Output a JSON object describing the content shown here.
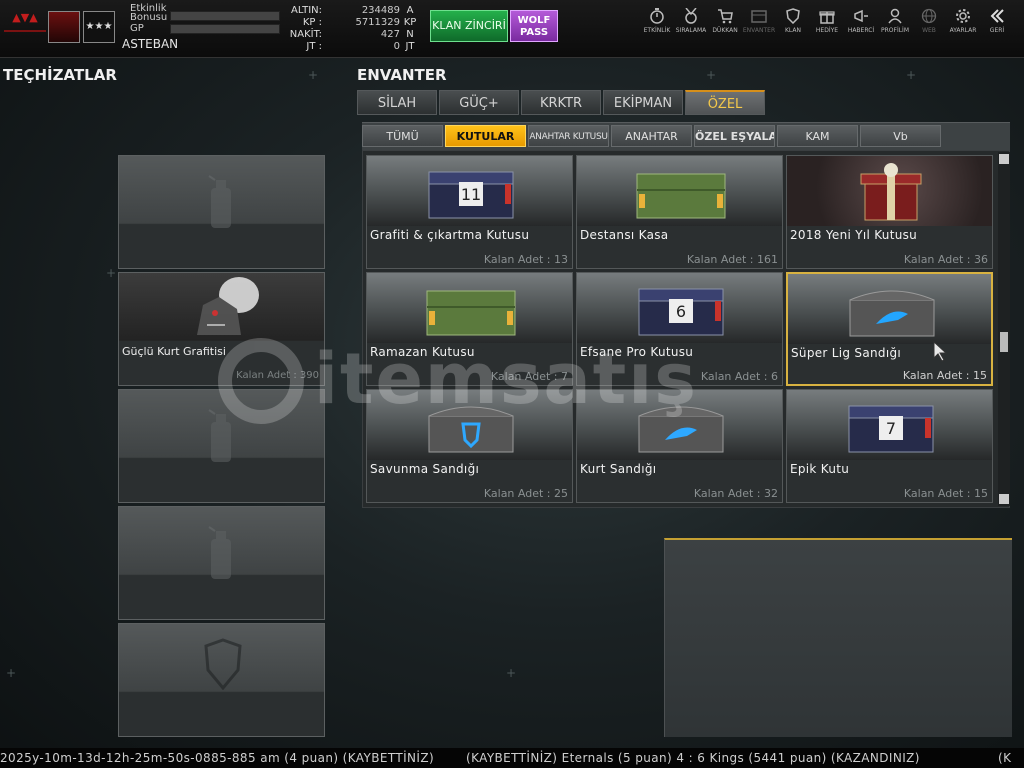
{
  "topbar": {
    "event_bonus_label_1": "Etkinlik",
    "event_bonus_label_2": "Bonusu",
    "gp_label": "GP",
    "player_name": "ASTEBAN",
    "currency": [
      {
        "key": "ALTIN:",
        "value": "234489",
        "unit": "A"
      },
      {
        "key": "KP :",
        "value": "5711329",
        "unit": "KP"
      },
      {
        "key": "NAKİT:",
        "value": "427",
        "unit": "N"
      },
      {
        "key": "JT :",
        "value": "0",
        "unit": "JT"
      }
    ],
    "klan_button": "KLAN ZİNCİRİ",
    "pass_button_1": "WOLF",
    "pass_button_2": "PASS",
    "nav": [
      {
        "label": "ETKİNLİK",
        "icon": "stopwatch-icon"
      },
      {
        "label": "SIRALAMA",
        "icon": "medal-icon"
      },
      {
        "label": "DÜKKAN",
        "icon": "cart-icon"
      },
      {
        "label": "ENVANTER",
        "icon": "inventory-icon"
      },
      {
        "label": "KLAN",
        "icon": "shield-icon"
      },
      {
        "label": "HEDİYE",
        "icon": "gift-icon"
      },
      {
        "label": "HABERCİ",
        "icon": "megaphone-icon"
      },
      {
        "label": "PROFİLİM",
        "icon": "user-icon"
      },
      {
        "label": "WEB",
        "icon": "globe-icon"
      },
      {
        "label": "AYARLAR",
        "icon": "gear-icon"
      },
      {
        "label": "GERİ",
        "icon": "back-icon"
      }
    ]
  },
  "left": {
    "title": "TEÇHİZATLAR",
    "slots": [
      {
        "name": "",
        "count": "",
        "icon": "spray-can-icon"
      },
      {
        "name": "Güçlü Kurt Grafitisi",
        "count": "Kalan Adet : 390",
        "icon": "wolf-graffiti-icon"
      },
      {
        "name": "",
        "count": "",
        "icon": "spray-can-icon"
      },
      {
        "name": "",
        "count": "",
        "icon": "spray-can-icon"
      },
      {
        "name": "",
        "count": "",
        "icon": "shield-slot-icon"
      }
    ]
  },
  "inventory": {
    "title": "ENVANTER",
    "tabs": [
      "SİLAH",
      "GÜÇ+",
      "KRKTR",
      "EKİPMAN",
      "ÖZEL"
    ],
    "active_tab": "ÖZEL",
    "subtabs": [
      "TÜMÜ",
      "KUTULAR",
      "ANAHTAR KUTUSU",
      "ANAHTAR",
      "ÖZEL EŞYALAR",
      "KAM",
      "Vb"
    ],
    "active_subtab": "KUTULAR",
    "items": [
      {
        "name": "Grafiti & çıkartma Kutusu",
        "count": "Kalan Adet : 13",
        "kind": "blue",
        "mark": "11"
      },
      {
        "name": "Destansı Kasa",
        "count": "Kalan Adet : 161",
        "kind": "green",
        "mark": ""
      },
      {
        "name": "2018 Yeni Yıl Kutusu",
        "count": "Kalan Adet : 36",
        "kind": "gift",
        "mark": ""
      },
      {
        "name": "Ramazan Kutusu",
        "count": "Kalan Adet : 7",
        "kind": "green",
        "mark": ""
      },
      {
        "name": "Efsane Pro Kutusu",
        "count": "Kalan Adet : 6",
        "kind": "blue",
        "mark": "6"
      },
      {
        "name": "Süper Lig Sandığı",
        "count": "Kalan Adet : 15",
        "kind": "chest",
        "mark": "wolf"
      },
      {
        "name": "Savunma Sandığı",
        "count": "Kalan Adet : 25",
        "kind": "chest",
        "mark": "shield"
      },
      {
        "name": "Kurt Sandığı",
        "count": "Kalan Adet : 32",
        "kind": "chest",
        "mark": "wolf"
      },
      {
        "name": "Epik Kutu",
        "count": "Kalan Adet : 15",
        "kind": "blue",
        "mark": "7"
      }
    ],
    "selected_index": 5
  },
  "ticker": {
    "part1": "2025y-10m-13d-12h-25m-50s-0885-885 am (4 puan) (KAYBETTİNİZ)",
    "part2": "(KAYBETTİNİZ) Eternals (5 puan) 4 : 6 Kings (5441 puan) (KAZANDINIZ)",
    "part3": "(K"
  },
  "watermark": "itemsatış",
  "colors": {
    "accent": "#f2b417",
    "klan": "#1f9b43",
    "pass": "#a24bcc"
  }
}
